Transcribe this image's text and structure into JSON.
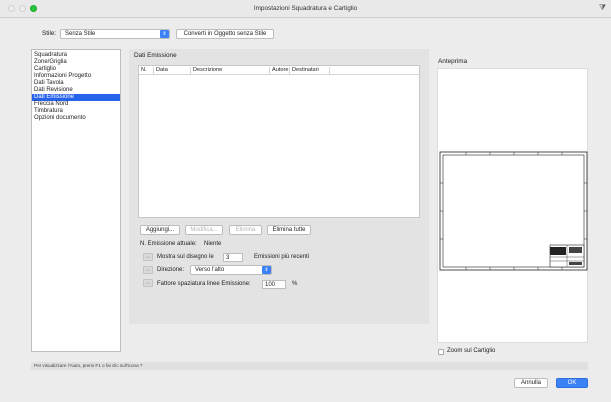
{
  "window": {
    "title": "Impostazioni Squadratura e Cartiglio"
  },
  "style_row": {
    "label": "Stile:",
    "selected": "Senza Stile",
    "convert_button": "Converti in Oggetto senza Stile"
  },
  "sidebar": {
    "items": [
      {
        "label": "Squadratura"
      },
      {
        "label": "Zone/Griglia"
      },
      {
        "label": "Cartiglio"
      },
      {
        "label": "Informazioni Progetto"
      },
      {
        "label": "Dati Tavola"
      },
      {
        "label": "Dati Revisione"
      },
      {
        "label": "Dati Emissione",
        "selected": true
      },
      {
        "label": "Freccia Nord"
      },
      {
        "label": "Timbratura"
      },
      {
        "label": "Opzioni documento"
      }
    ]
  },
  "main": {
    "section_title": "Dati Emissione",
    "columns": [
      "N.",
      "Data",
      "Descrizione",
      "Autore",
      "Destinatari"
    ],
    "buttons": {
      "add": "Aggiungi...",
      "edit": "Modifica...",
      "delete": "Elimina",
      "delete_all": "Elimina tutte"
    },
    "current_issue_label": "N. Emissione attuale:",
    "current_issue_value": "Niente",
    "show_label": "Mostra sul disegno le",
    "show_value": "3",
    "show_suffix": "Emissioni più recenti",
    "direction_label": "Direzione:",
    "direction_value": "Verso l'alto",
    "spacing_label": "Fattore spaziatura linee Emissione:",
    "spacing_value": "100",
    "spacing_unit": "%"
  },
  "preview": {
    "label": "Anteprima",
    "zoom_label": "Zoom sul Cartiglio",
    "zoom_checked": false
  },
  "status_bar": {
    "text": "Per visualizzare l'Aiuto, premi F1 o fai clic sull'icona ?"
  },
  "footer": {
    "cancel": "Annulla",
    "ok": "OK"
  },
  "colors": {
    "accent": "#3b82f6",
    "selection": "#2563eb"
  }
}
